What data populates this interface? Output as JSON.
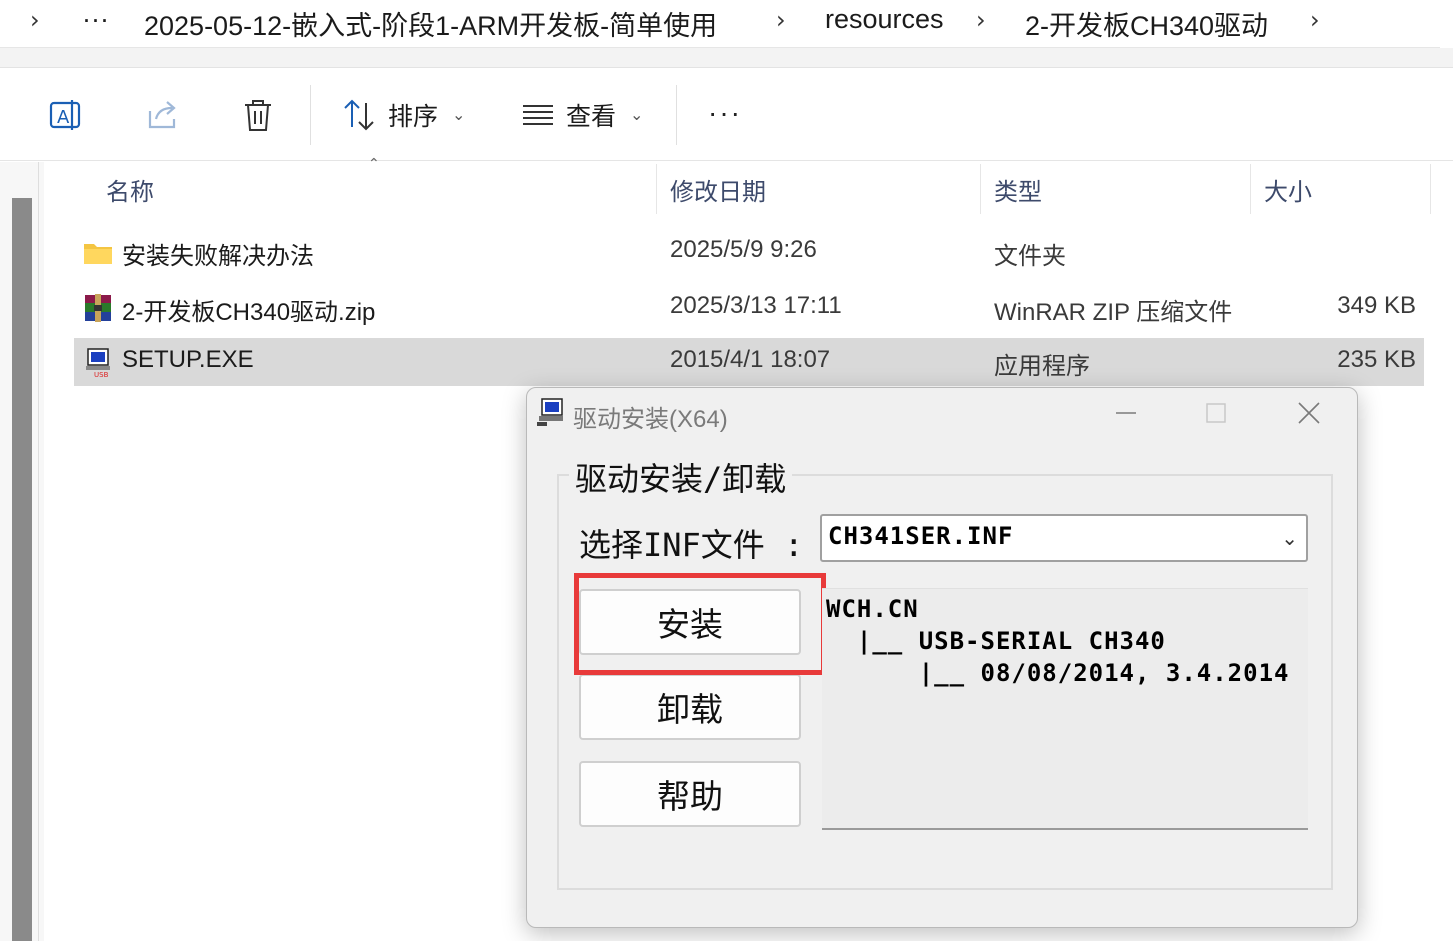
{
  "breadcrumb": {
    "more": "···",
    "items": [
      "2025-05-12-嵌入式-阶段1-ARM开发板-简单使用",
      "resources",
      "2-开发板CH340驱动"
    ]
  },
  "toolbar": {
    "sort_label": "排序",
    "view_label": "查看",
    "more_label": "···"
  },
  "columns": {
    "name": "名称",
    "date": "修改日期",
    "type": "类型",
    "size": "大小"
  },
  "files": [
    {
      "name": "安装失败解决办法",
      "date": "2025/5/9 9:26",
      "type": "文件夹",
      "size": "",
      "icon": "folder-icon"
    },
    {
      "name": "2-开发板CH340驱动.zip",
      "date": "2025/3/13 17:11",
      "type": "WinRAR ZIP 压缩文件",
      "size": "349 KB",
      "icon": "winrar-archive-icon"
    },
    {
      "name": "SETUP.EXE",
      "date": "2015/4/1 18:07",
      "type": "应用程序",
      "size": "235 KB",
      "icon": "usb-setup-icon",
      "selected": true
    }
  ],
  "dialog": {
    "title": "驱动安装(X64)",
    "group_label": "驱动安装/卸载",
    "inf_label": "选择INF文件 :",
    "inf_value": "CH341SER.INF",
    "install_button": "安装",
    "uninstall_button": "卸载",
    "help_button": "帮助",
    "info_lines": [
      "WCH.CN",
      "  |__ USB-SERIAL CH340",
      "      |__ 08/08/2014, 3.4.2014"
    ]
  },
  "colors": {
    "highlight": "#e83a3a",
    "selected_row": "#d9d9d9",
    "header_text": "#3d4a6b"
  }
}
